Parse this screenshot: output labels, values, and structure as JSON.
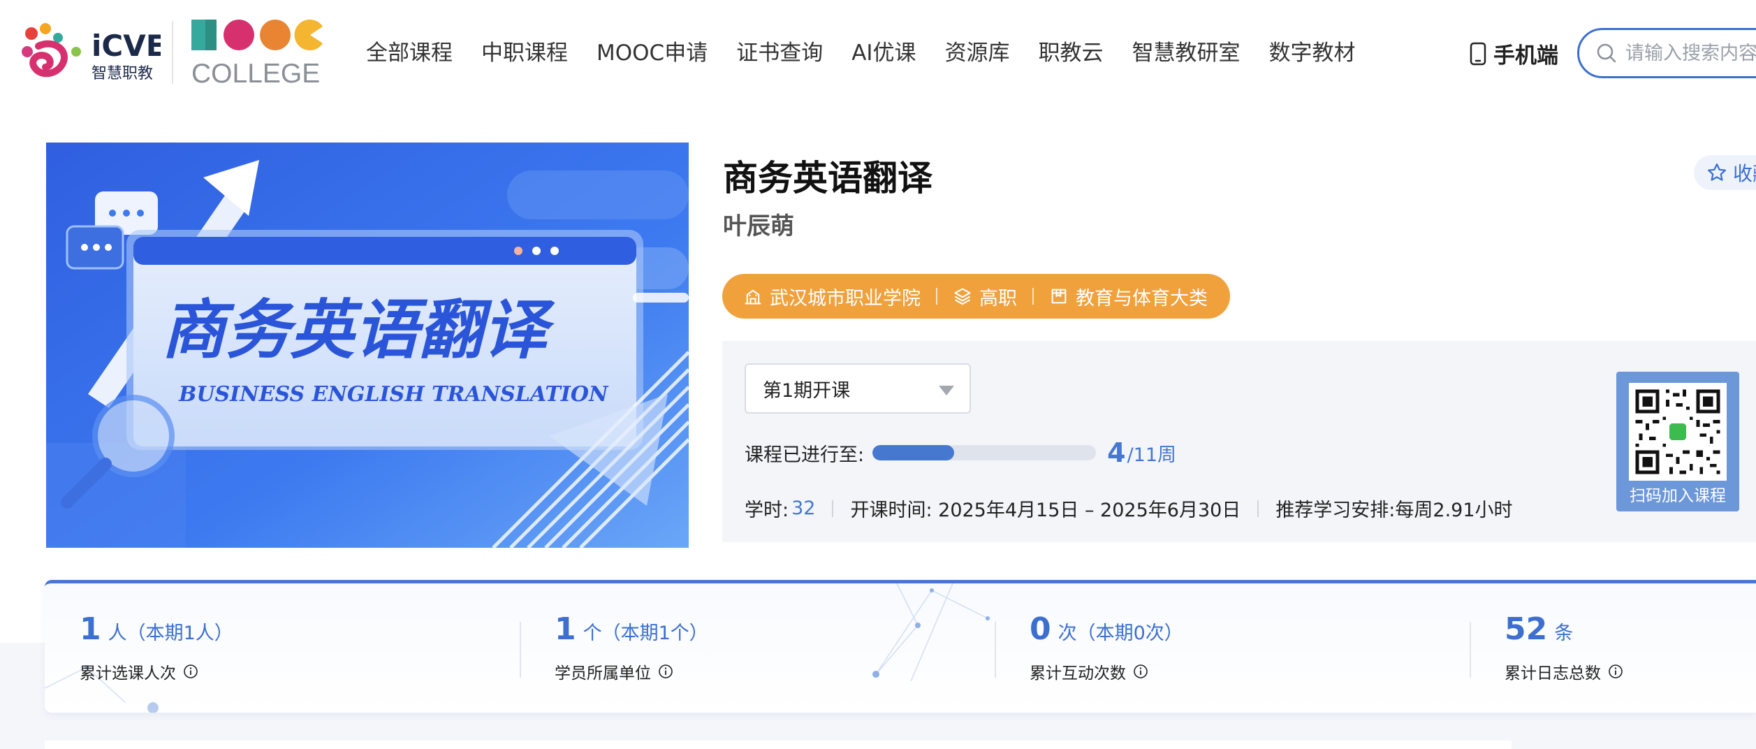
{
  "header": {
    "logo_icve_text": "iCVE",
    "logo_icve_sub": "智慧职教",
    "logo_mooc_text": "MOOC",
    "logo_college_text": "COLLEGE",
    "nav": [
      "全部课程",
      "中职课程",
      "MOOC申请",
      "证书查询",
      "AI优课",
      "资源库",
      "职教云",
      "智慧教研室",
      "数字教材"
    ],
    "mobile_label": "手机端",
    "search_placeholder": "请输入搜索内容"
  },
  "course": {
    "title": "商务英语翻译",
    "teacher": "叶辰萌",
    "collect_label": "收藏",
    "cover_title_cn": "商务英语翻译",
    "cover_title_en": "BUSINESS ENGLISH TRANSLATION",
    "tags": {
      "school": "武汉城市职业学院",
      "level": "高职",
      "category": "教育与体育大类"
    },
    "term_select": "第1期开课",
    "progress_label": "课程已进行至:",
    "progress_current": "4",
    "progress_total": "/11周",
    "progress_fraction": 0.364,
    "hours_label": "学时:",
    "hours_value": "32",
    "date_range": "开课时间: 2025年4月15日 – 2025年6月30日",
    "schedule": "推荐学习安排:每周2.91小时",
    "qr_label": "扫码加入课程"
  },
  "stats": [
    {
      "num": "1",
      "unit": "人（本期1人）",
      "label": "累计选课人次"
    },
    {
      "num": "1",
      "unit": "个（本期1个）",
      "label": "学员所属单位"
    },
    {
      "num": "0",
      "unit": "次（本期0次）",
      "label": "累计互动次数"
    },
    {
      "num": "52",
      "unit": "条",
      "label": "累计日志总数"
    }
  ],
  "colors": {
    "accent": "#3c6fd0",
    "tag_bg": "#f0a13c",
    "progress_fill": "#4678d0",
    "qr_bg": "#6c97d9"
  }
}
